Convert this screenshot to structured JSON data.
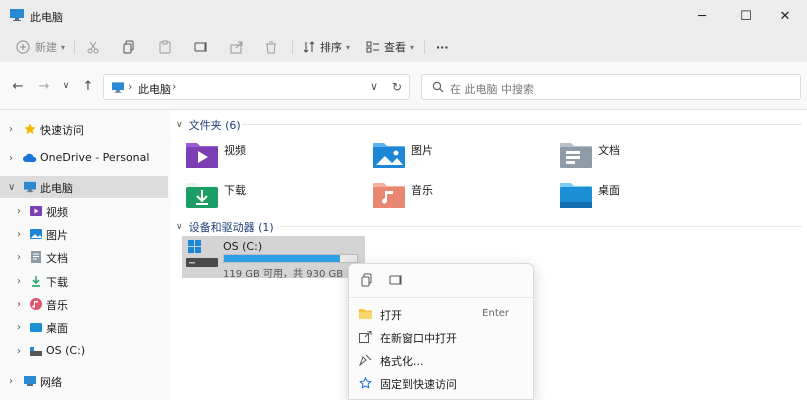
{
  "window": {
    "title": "此电脑"
  },
  "toolbar": {
    "new_label": "新建",
    "sort_label": "排序",
    "view_label": "查看",
    "more_label": "···"
  },
  "address": {
    "path": "此电脑",
    "search_placeholder": "在 此电脑 中搜索"
  },
  "sidebar": {
    "items": [
      {
        "label": "快速访问"
      },
      {
        "label": "OneDrive - Personal"
      },
      {
        "label": "此电脑"
      },
      {
        "label": "视频"
      },
      {
        "label": "图片"
      },
      {
        "label": "文档"
      },
      {
        "label": "下载"
      },
      {
        "label": "音乐"
      },
      {
        "label": "桌面"
      },
      {
        "label": "OS (C:)"
      },
      {
        "label": "网络"
      }
    ]
  },
  "content": {
    "folders_header": "文件夹 (6)",
    "folders": [
      {
        "label": "视频",
        "icon": "video-folder-icon"
      },
      {
        "label": "图片",
        "icon": "pictures-folder-icon"
      },
      {
        "label": "文档",
        "icon": "documents-folder-icon"
      },
      {
        "label": "下载",
        "icon": "downloads-folder-icon"
      },
      {
        "label": "音乐",
        "icon": "music-folder-icon"
      },
      {
        "label": "桌面",
        "icon": "desktop-folder-icon"
      }
    ],
    "drives_header": "设备和驱动器 (1)",
    "drive": {
      "label": "OS (C:)",
      "info": "119 GB 可用，共 930 GB",
      "used_fraction": 0.872
    }
  },
  "context_menu": {
    "items": [
      {
        "label": "打开",
        "shortcut": "Enter"
      },
      {
        "label": "在新窗口中打开"
      },
      {
        "label": "格式化..."
      },
      {
        "label": "固定到快速访问"
      }
    ]
  },
  "colors": {
    "accent": "#2f9fe6",
    "selected": "#dcdcdc",
    "header_text": "#1f3f77"
  }
}
